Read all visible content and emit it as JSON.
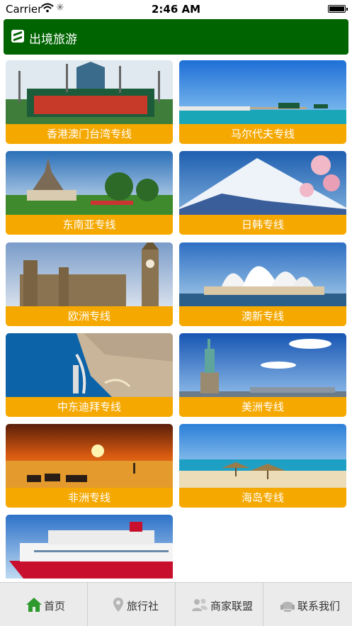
{
  "status_bar": {
    "carrier": "Carrier",
    "time": "2:46 AM"
  },
  "header": {
    "title": "出境旅游"
  },
  "routes": [
    {
      "label": "香港澳门台湾专线",
      "image": "disneyland-castle-photo"
    },
    {
      "label": "马尔代夫专线",
      "image": "maldives-pier-photo"
    },
    {
      "label": "东南亚专线",
      "image": "thai-temple-photo"
    },
    {
      "label": "日韩专线",
      "image": "mount-fuji-photo"
    },
    {
      "label": "欧洲专线",
      "image": "big-ben-photo"
    },
    {
      "label": "澳新专线",
      "image": "sydney-opera-house-photo"
    },
    {
      "label": "中东迪拜专线",
      "image": "dubai-coast-photo"
    },
    {
      "label": "美洲专线",
      "image": "statue-of-liberty-photo"
    },
    {
      "label": "非洲专线",
      "image": "africa-sunset-zebra-photo"
    },
    {
      "label": "海岛专线",
      "image": "island-beach-photo"
    },
    {
      "label": "",
      "image": "cruise-ship-photo"
    }
  ],
  "bottom_nav": [
    {
      "label": "首页",
      "icon": "home-icon",
      "active": true
    },
    {
      "label": "旅行社",
      "icon": "location-pin-icon",
      "active": false
    },
    {
      "label": "商家联盟",
      "icon": "users-icon",
      "active": false
    },
    {
      "label": "联系我们",
      "icon": "headset-icon",
      "active": false
    }
  ],
  "colors": {
    "header_green": "#006400",
    "label_orange": "#f5a800",
    "nav_background": "#ebebeb",
    "active_icon_green": "#2e9a2e"
  }
}
